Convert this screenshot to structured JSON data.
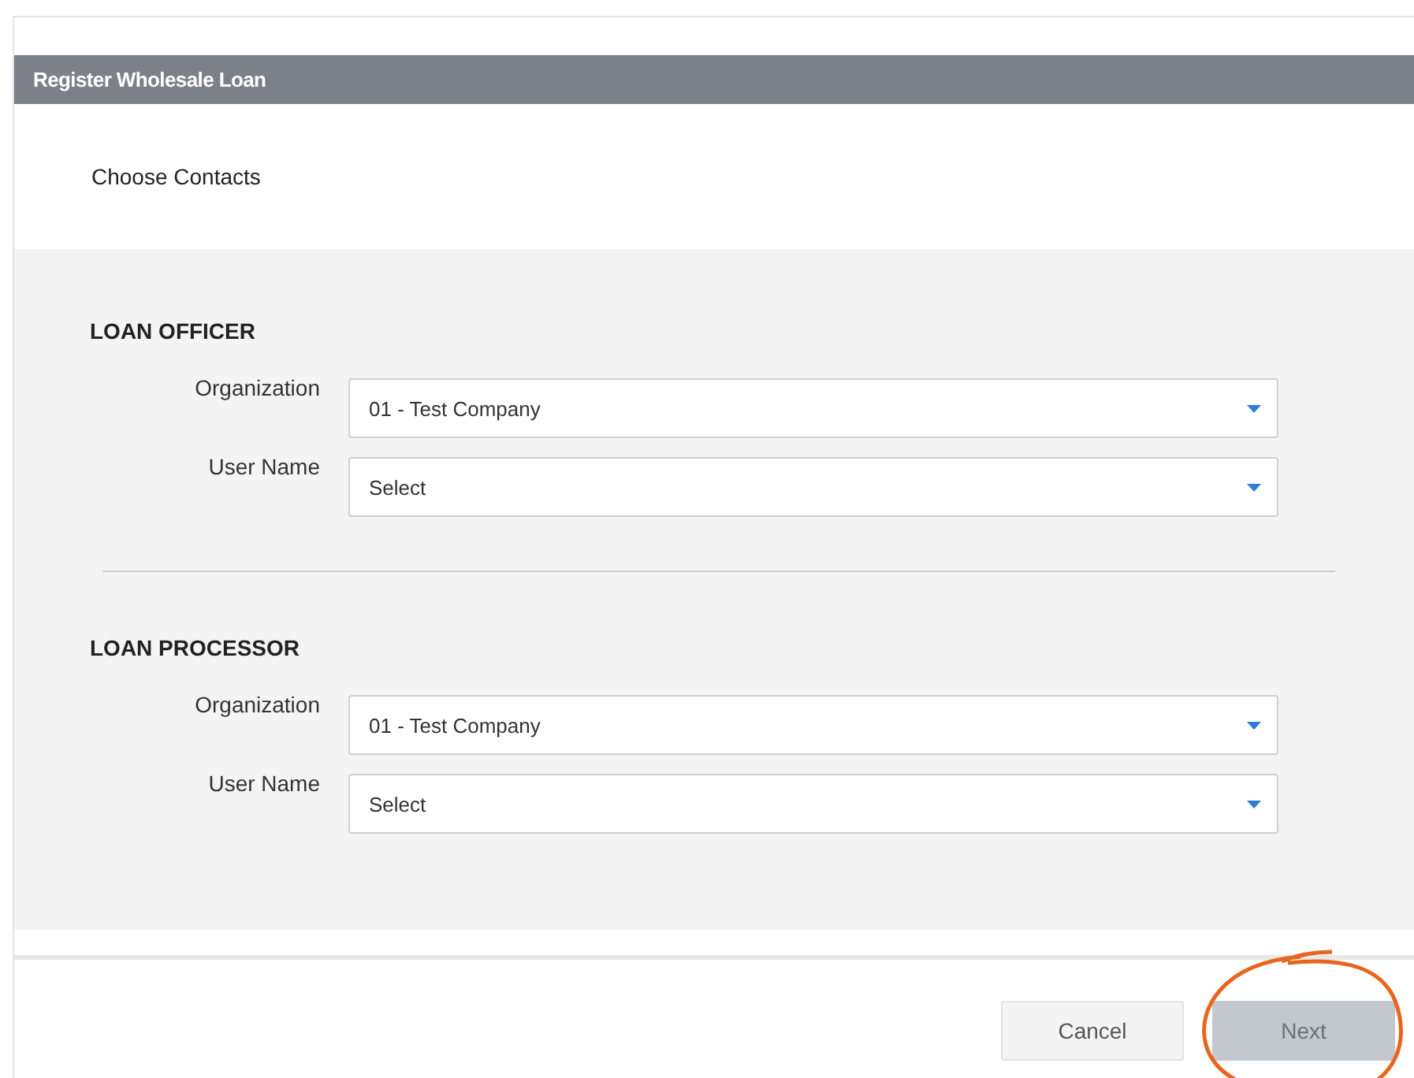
{
  "window": {
    "title": "Register Wholesale Loan"
  },
  "step_title": "Choose Contacts",
  "sections": [
    {
      "heading": "LOAN OFFICER",
      "fields": [
        {
          "label": "Organization",
          "value": "01 - Test Company"
        },
        {
          "label": "User Name",
          "value": "Select"
        }
      ]
    },
    {
      "heading": "LOAN PROCESSOR",
      "fields": [
        {
          "label": "Organization",
          "value": "01 - Test Company"
        },
        {
          "label": "User Name",
          "value": "Select"
        }
      ]
    }
  ],
  "buttons": [
    {
      "label": "Cancel",
      "kind": "secondary",
      "disabled": false,
      "circled": false
    },
    {
      "label": "Next",
      "kind": "primary",
      "disabled": true,
      "circled": true
    }
  ]
}
